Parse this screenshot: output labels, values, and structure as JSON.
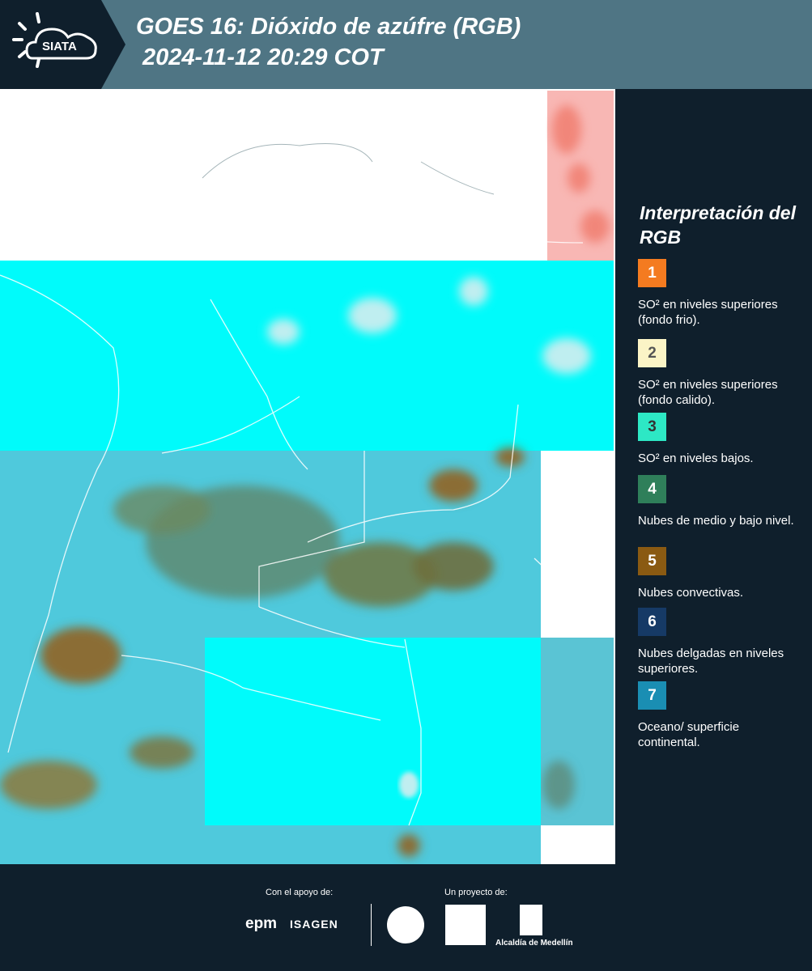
{
  "header": {
    "logo_text": "SIATA",
    "title_line1": "GOES 16: Dióxido de azúfre (RGB)",
    "title_line2": "2024-11-12 20:29 COT"
  },
  "legend": {
    "title": "Interpretación del RGB",
    "items": [
      {
        "number": "1",
        "label": "SO² en niveles superiores (fondo frio).",
        "color": "#f47b20",
        "text_color": "#ffffff"
      },
      {
        "number": "2",
        "label": "SO² en niveles superiores (fondo calido).",
        "color": "#fbf4c6",
        "text_color": "#555555"
      },
      {
        "number": "3",
        "label": "SO² en niveles bajos.",
        "color": "#2de8c5",
        "text_color": "#333333"
      },
      {
        "number": "4",
        "label": "Nubes de medio y bajo nivel.",
        "color": "#2f7f5a",
        "text_color": "#ffffff"
      },
      {
        "number": "5",
        "label": "Nubes convectivas.",
        "color": "#8a5a12",
        "text_color": "#ffffff"
      },
      {
        "number": "6",
        "label": "Nubes delgadas en niveles superiores.",
        "color": "#163a66",
        "text_color": "#ffffff"
      },
      {
        "number": "7",
        "label": "Oceano/ superficie continental.",
        "color": "#1a8eb3",
        "text_color": "#ffffff"
      }
    ]
  },
  "footer": {
    "support_label": "Con el apoyo de:",
    "project_label": "Un proyecto de:",
    "epm": "epm",
    "isagen": "ISAGEN",
    "alcaldia": "Alcaldía de Medellín"
  },
  "map": {
    "colors": {
      "cyan": "#00fbfb",
      "satellite_base": "#4fc9dc",
      "convective": "#8b6d34",
      "pink": "#f8b7b4"
    }
  }
}
